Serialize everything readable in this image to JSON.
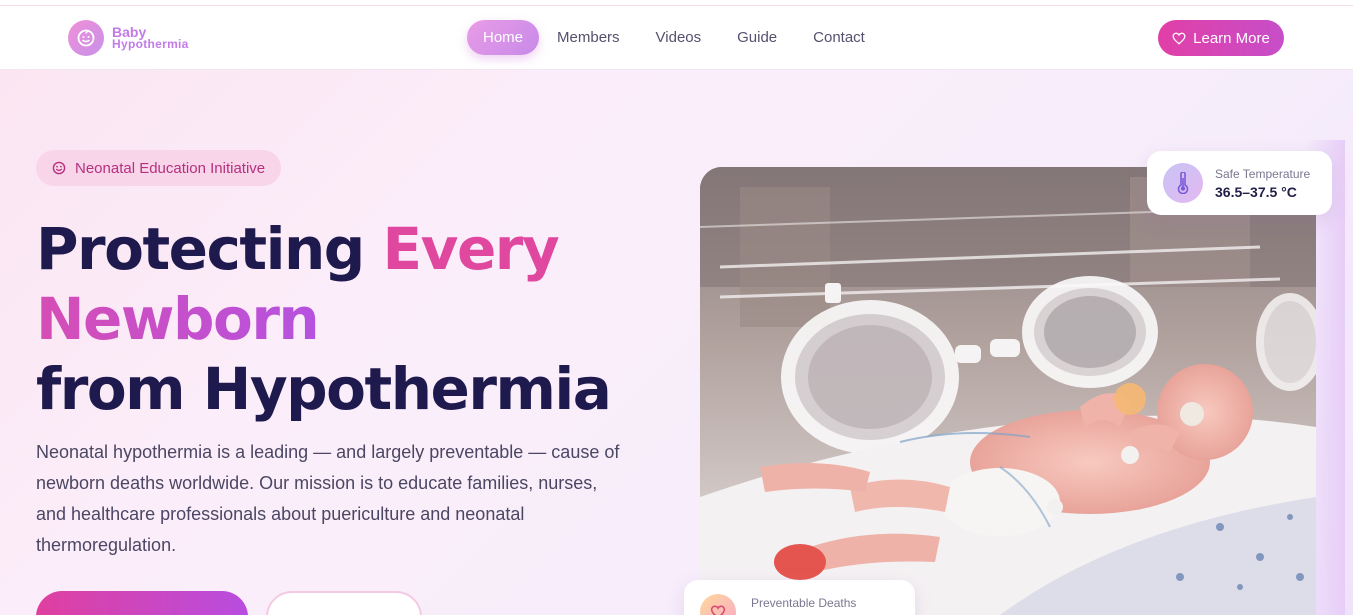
{
  "brand": {
    "line1": "Baby",
    "line2": "Hypothermia",
    "logo_icon": "baby-face-icon"
  },
  "nav": {
    "items": [
      {
        "label": "Home",
        "active": true
      },
      {
        "label": "Members",
        "active": false
      },
      {
        "label": "Videos",
        "active": false
      },
      {
        "label": "Guide",
        "active": false
      },
      {
        "label": "Contact",
        "active": false
      }
    ],
    "cta_label": "Learn More",
    "cta_icon": "heart-icon"
  },
  "hero": {
    "badge": "Neonatal Education Initiative",
    "badge_icon": "smile-icon",
    "title_part1": "Protecting ",
    "title_highlight1": "Every",
    "title_highlight2": "Newborn",
    "title_part2": "from Hypothermia",
    "description": "Neonatal hypothermia is a leading — and largely preventable — cause of newborn deaths worldwide. Our mission is to educate families, nurses, and healthcare professionals about puericulture and neonatal thermoregulation."
  },
  "cards": {
    "temperature": {
      "label": "Safe Temperature",
      "value": "36.5–37.5 °C",
      "icon": "thermometer-icon"
    },
    "deaths": {
      "label": "Preventable Deaths",
      "icon": "heart-icon"
    }
  },
  "colors": {
    "primary_pink": "#e13fa6",
    "purple": "#b552e0",
    "navy": "#1f1a4d",
    "background": "#fbeefa"
  }
}
